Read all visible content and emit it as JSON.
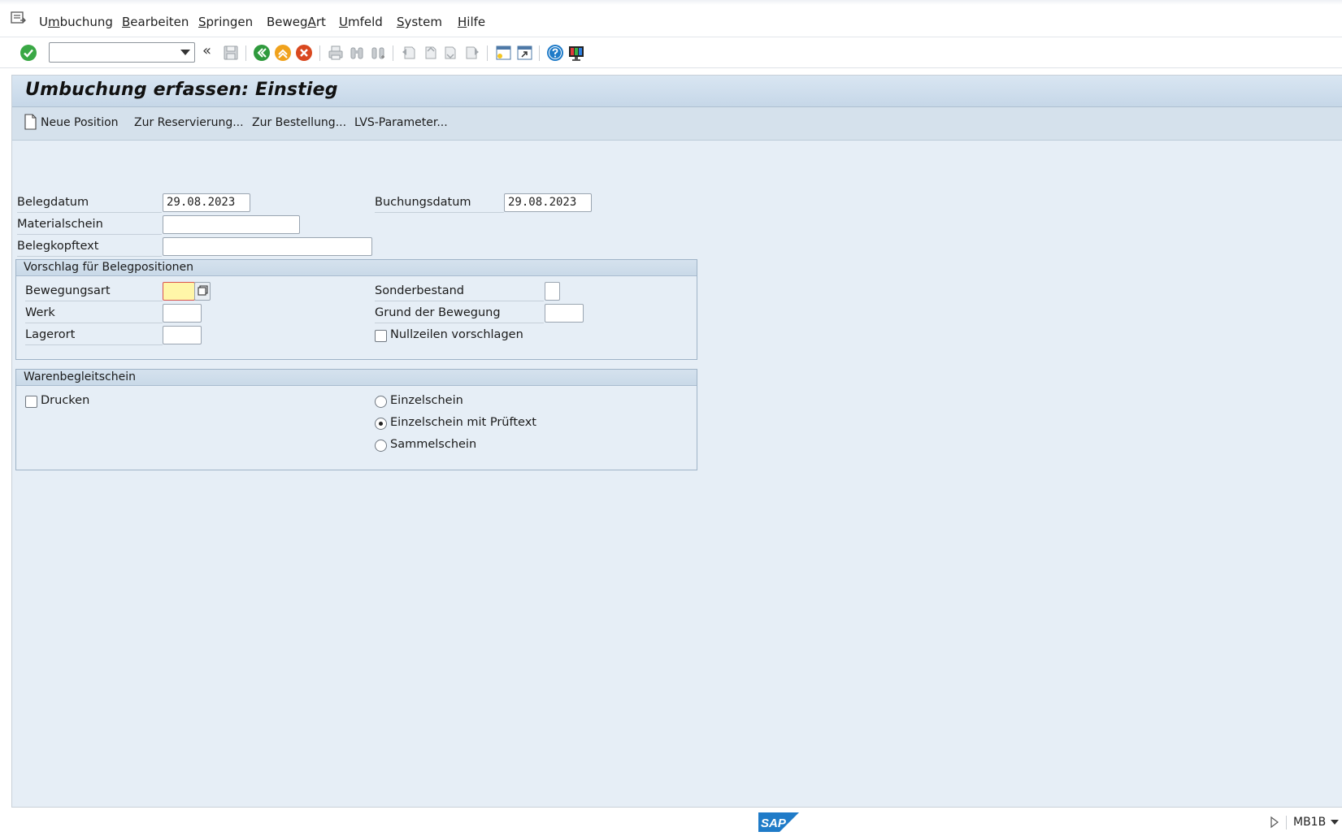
{
  "menu": {
    "items": [
      {
        "pre": "U",
        "ul": "m",
        "post": "buchung"
      },
      {
        "pre": "",
        "ul": "B",
        "post": "earbeiten"
      },
      {
        "pre": "",
        "ul": "S",
        "post": "pringen"
      },
      {
        "pre": "Beweg",
        "ul": "A",
        "post": "rt"
      },
      {
        "pre": "",
        "ul": "U",
        "post": "mfeld"
      },
      {
        "pre": "",
        "ul": "S",
        "post": "ystem"
      },
      {
        "pre": "",
        "ul": "H",
        "post": "ilfe"
      }
    ]
  },
  "toolbar": {
    "command_value": "",
    "chevrons": "«"
  },
  "screen": {
    "title": "Umbuchung erfassen: Einstieg"
  },
  "appbar": {
    "new_item": "Neue Position",
    "reservation": "Zur Reservierung...",
    "order": "Zur Bestellung...",
    "lvs": "LVS-Parameter..."
  },
  "header": {
    "belegdatum_label": "Belegdatum",
    "belegdatum_value": "29.08.2023",
    "buchungsdatum_label": "Buchungsdatum",
    "buchungsdatum_value": "29.08.2023",
    "materialschein_label": "Materialschein",
    "materialschein_value": "",
    "belegkopftext_label": "Belegkopftext",
    "belegkopftext_value": ""
  },
  "defaults": {
    "title": "Vorschlag für Belegpositionen",
    "bewegungsart_label": "Bewegungsart",
    "bewegungsart_value": "",
    "werk_label": "Werk",
    "werk_value": "",
    "lagerort_label": "Lagerort",
    "lagerort_value": "",
    "sonderbestand_label": "Sonderbestand",
    "sonderbestand_value": "",
    "grund_label": "Grund der Bewegung",
    "grund_value": "",
    "nullzeilen_label": "Nullzeilen vorschlagen"
  },
  "slip": {
    "title": "Warenbegleitschein",
    "drucken_label": "Drucken",
    "einzelschein_label": "Einzelschein",
    "einzelschein_pruef_label": "Einzelschein mit Prüftext",
    "sammelschein_label": "Sammelschein",
    "selected": "Einzelschein mit Prüftext"
  },
  "status": {
    "logo": "SAP",
    "tcode": "MB1B"
  },
  "colors": {
    "ok_green": "#3aa845",
    "back_green": "#2f9a3d",
    "exit_orange": "#f0a21c",
    "cancel_red": "#d9481f",
    "sap_blue": "#1f7bc8",
    "focus_yellow": "#fff6a8"
  }
}
